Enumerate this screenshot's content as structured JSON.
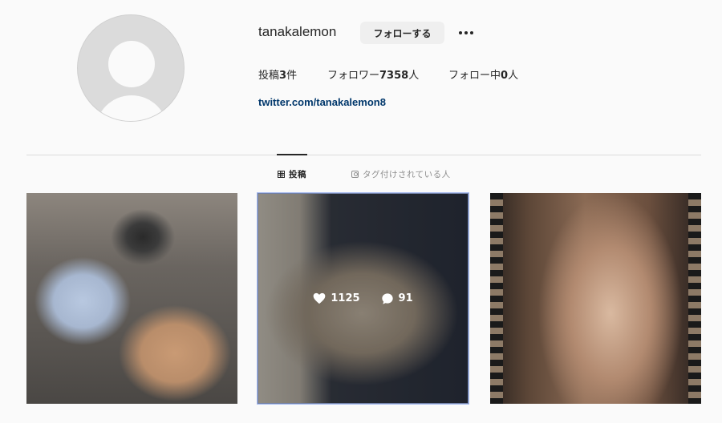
{
  "profile": {
    "username": "tanakalemon",
    "follow_label": "フォローする",
    "stats": {
      "posts_prefix": "投稿",
      "posts_count": "3",
      "posts_suffix": "件",
      "followers_prefix": "フォロワー",
      "followers_count": "7358",
      "followers_suffix": "人",
      "following_prefix": "フォロー中",
      "following_count": "0",
      "following_suffix": "人"
    },
    "link": "twitter.com/tanakalemon8"
  },
  "tabs": [
    {
      "label": "投稿",
      "icon": "grid-icon",
      "active": true
    },
    {
      "label": "タグ付けされている人",
      "icon": "tag-icon",
      "active": false
    }
  ],
  "posts": [
    {
      "description": "dog and cat"
    },
    {
      "likes": "1125",
      "comments": "91"
    },
    {
      "description": "portrait"
    }
  ],
  "colors": {
    "background": "#fafafa",
    "link": "#00376b",
    "button": "#efefef",
    "hover_outline": "#a3b8ee"
  }
}
